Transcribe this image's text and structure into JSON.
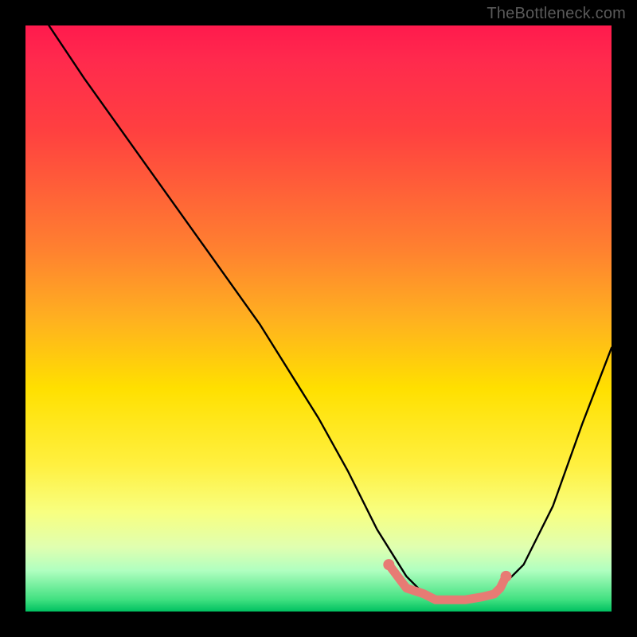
{
  "watermark": "TheBottleneck.com",
  "chart_data": {
    "type": "line",
    "title": "",
    "xlabel": "",
    "ylabel": "",
    "xlim": [
      0,
      100
    ],
    "ylim": [
      0,
      100
    ],
    "series": [
      {
        "name": "curve",
        "color": "#000000",
        "x": [
          4,
          10,
          20,
          30,
          40,
          50,
          55,
          60,
          65,
          68,
          70,
          75,
          80,
          85,
          90,
          95,
          100
        ],
        "y": [
          100,
          91,
          77,
          63,
          49,
          33,
          24,
          14,
          6,
          3,
          2,
          2,
          3,
          8,
          18,
          32,
          45
        ]
      },
      {
        "name": "highlight",
        "color": "#e77b74",
        "x": [
          62,
          65,
          68,
          70,
          72,
          75,
          78,
          80,
          81,
          82
        ],
        "y": [
          8,
          4,
          3,
          2,
          2,
          2,
          2.5,
          3,
          4,
          6
        ]
      }
    ],
    "highlight_endpoints": [
      {
        "x": 62,
        "y": 8
      },
      {
        "x": 82,
        "y": 6
      }
    ]
  }
}
